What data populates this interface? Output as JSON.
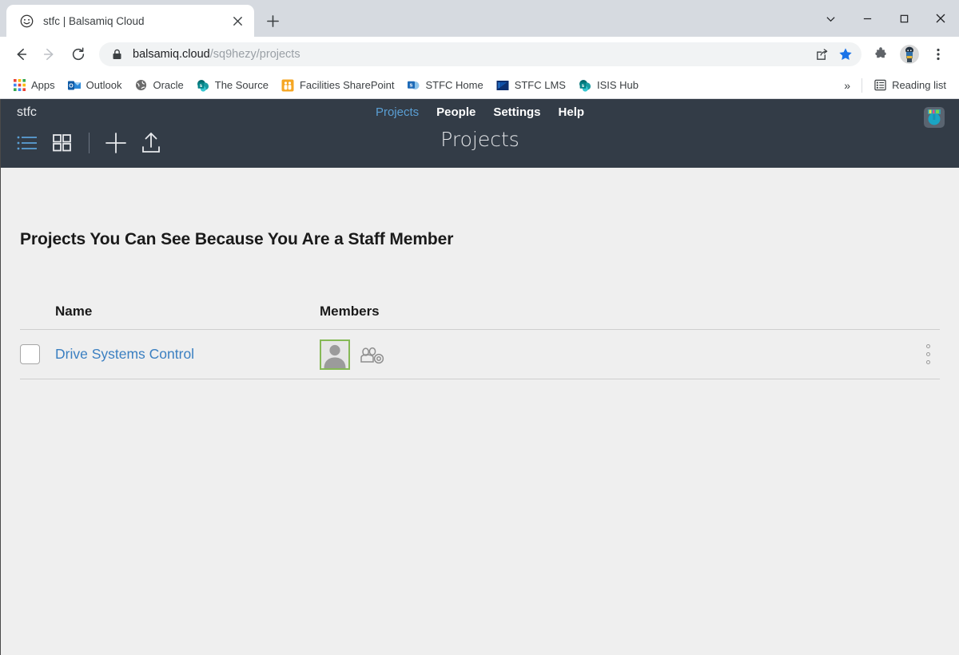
{
  "window": {
    "controls": [
      "tab-search-chevron",
      "minimize",
      "maximize",
      "close"
    ]
  },
  "tab": {
    "title": "stfc | Balsamiq Cloud",
    "favicon": "smiley-face-icon",
    "close_label": "×",
    "newtab_label": "+"
  },
  "toolbar": {
    "back": "←",
    "forward": "→",
    "reload": "⟳",
    "url_secure": "balsamiq.cloud",
    "url_path": "/sq9hezy/projects",
    "lock_icon": "lock-icon",
    "share_icon": "share-icon",
    "star_icon": "star-filled-icon",
    "extensions_icon": "puzzle-piece-icon",
    "profile_icon": "profile-avatar",
    "menu_icon": "three-dot-menu-icon"
  },
  "bookmarks": {
    "items": [
      {
        "label": "Apps",
        "icon": "apps-grid-icon"
      },
      {
        "label": "Outlook",
        "icon": "outlook-icon"
      },
      {
        "label": "Oracle",
        "icon": "oracle-globe-icon"
      },
      {
        "label": "The Source",
        "icon": "sharepoint-icon"
      },
      {
        "label": "Facilities SharePoint",
        "icon": "facilities-icon"
      },
      {
        "label": "STFC Home",
        "icon": "sharepoint-blue-icon"
      },
      {
        "label": "STFC LMS",
        "icon": "lms-triangle-icon"
      },
      {
        "label": "ISIS Hub",
        "icon": "sharepoint-teal-icon"
      }
    ],
    "overflow": "»",
    "reading_list": "Reading list",
    "reading_list_icon": "reading-list-icon"
  },
  "app": {
    "logo": "stfc",
    "nav": [
      {
        "label": "Projects",
        "active": true
      },
      {
        "label": "People",
        "active": false
      },
      {
        "label": "Settings",
        "active": false
      },
      {
        "label": "Help",
        "active": false
      }
    ],
    "tools": [
      {
        "name": "list-view-icon",
        "active": true
      },
      {
        "name": "grid-view-icon",
        "active": false
      },
      {
        "name": "add-project-icon",
        "active": false
      },
      {
        "name": "upload-icon",
        "active": false
      }
    ],
    "page_title": "Projects",
    "user_avatar": "user-avatar"
  },
  "main": {
    "section_title": "Projects You Can See Because You Are a Staff Member",
    "columns": [
      "Name",
      "Members"
    ],
    "rows": [
      {
        "checked": false,
        "name": "Drive Systems Control",
        "members": [
          {
            "type": "avatar",
            "label": "member-avatar"
          },
          {
            "type": "viewers",
            "label": "viewers-icon"
          }
        ],
        "menu": "row-menu"
      }
    ]
  },
  "colors": {
    "app_header": "#333c47",
    "accent_blue": "#5a9fd4",
    "link_blue": "#3a7fc1",
    "avatar_green": "#86b956",
    "page_bg": "#efefef"
  }
}
